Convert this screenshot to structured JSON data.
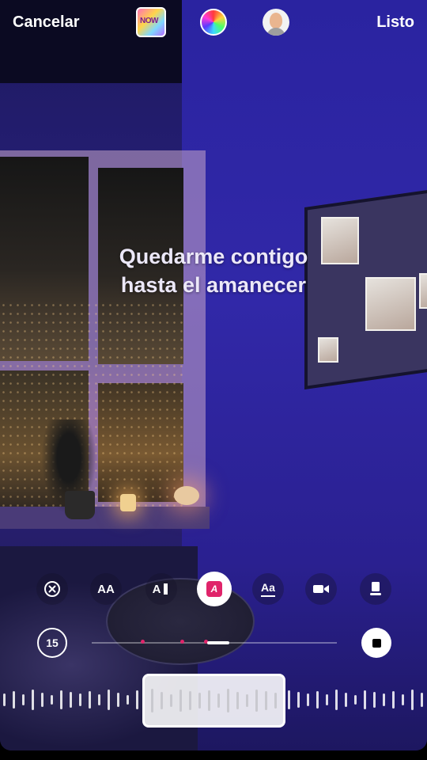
{
  "topbar": {
    "cancel_label": "Cancelar",
    "done_label": "Listo",
    "album_art_text": "NOW"
  },
  "lyrics": {
    "line1": "Quedarme contigo",
    "line2": "hasta el amanecer"
  },
  "toolbar": {
    "items": [
      {
        "icon": "remove-lyrics-icon",
        "label": ""
      },
      {
        "icon": "text-size-icon",
        "label": "AA"
      },
      {
        "icon": "text-style-icon",
        "label": "A"
      },
      {
        "icon": "highlight-style-icon",
        "label": "A",
        "selected": true
      },
      {
        "icon": "karaoke-style-icon",
        "label": "Aa"
      },
      {
        "icon": "video-clip-icon",
        "label": ""
      },
      {
        "icon": "sticker-card-icon",
        "label": ""
      }
    ]
  },
  "timeline": {
    "duration_label": "15",
    "progress_fraction": 0.09,
    "accent_color": "#e0246a"
  },
  "colors": {
    "background": "#27207a",
    "accent": "#e0246a"
  }
}
